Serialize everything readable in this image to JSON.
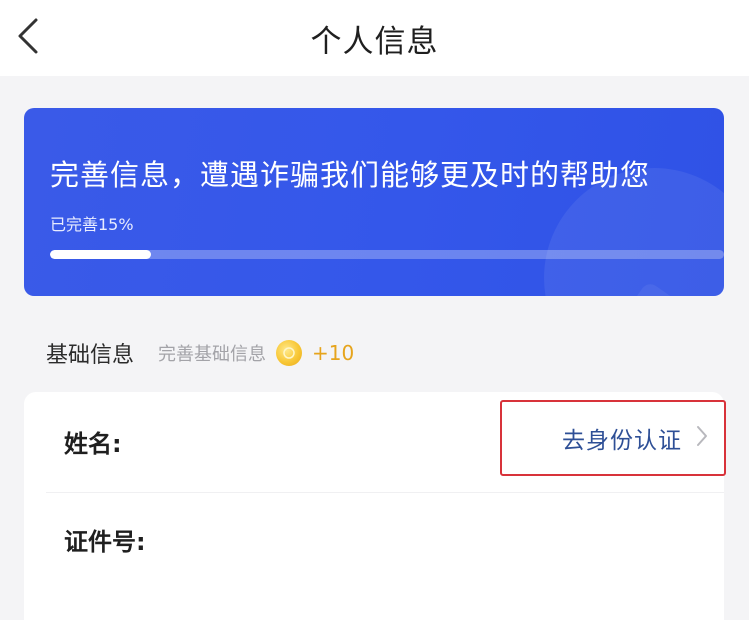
{
  "nav": {
    "title": "个人信息"
  },
  "banner": {
    "title": "完善信息，遭遇诈骗我们能够更及时的帮助您",
    "progress_text": "已完善15%",
    "progress_percent": 15
  },
  "section": {
    "title": "基础信息",
    "hint": "完善基础信息",
    "bonus": "+10"
  },
  "form": {
    "name_label": "姓名:",
    "verify_label": "去身份认证",
    "id_label": "证件号:"
  },
  "colors": {
    "banner_blue": "#3457ea",
    "verify_text": "#2e4f96",
    "highlight_border": "#d8323a",
    "coin": "#f8c736"
  },
  "icons": {
    "back": "chevron-left-icon",
    "coin": "coin-icon",
    "forward": "chevron-right-icon"
  }
}
